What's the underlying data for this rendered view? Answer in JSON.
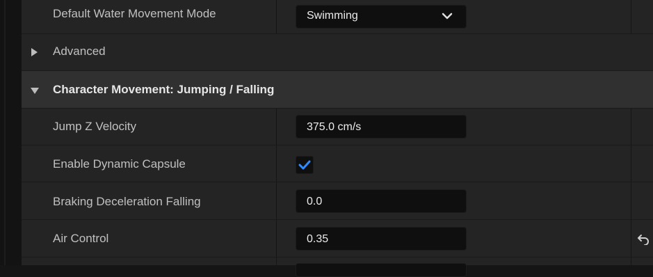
{
  "rows": {
    "water_mode": {
      "label": "Default Water Movement Mode",
      "value": "Swimming"
    },
    "advanced": {
      "label": "Advanced"
    },
    "category": {
      "label": "Character Movement: Jumping / Falling"
    },
    "jump_z_velocity": {
      "label": "Jump Z Velocity",
      "value": "375.0 cm/s"
    },
    "enable_dynamic_capsule": {
      "label": "Enable Dynamic Capsule",
      "checked": true
    },
    "braking_deceleration_falling": {
      "label": "Braking Deceleration Falling",
      "value": "0.0"
    },
    "air_control": {
      "label": "Air Control",
      "value": "0.35",
      "has_reset": true
    }
  },
  "colors": {
    "panel_bg": "#242424",
    "category_bg": "#303030",
    "field_bg": "#0f0f0f",
    "accent_check": "#2f8bff"
  },
  "icons": {
    "dropdown": "chevron-down-icon",
    "expander_collapsed": "triangle-right-icon",
    "expander_expanded": "triangle-down-icon",
    "check": "checkmark-icon",
    "reset": "reset-arrow-icon"
  }
}
